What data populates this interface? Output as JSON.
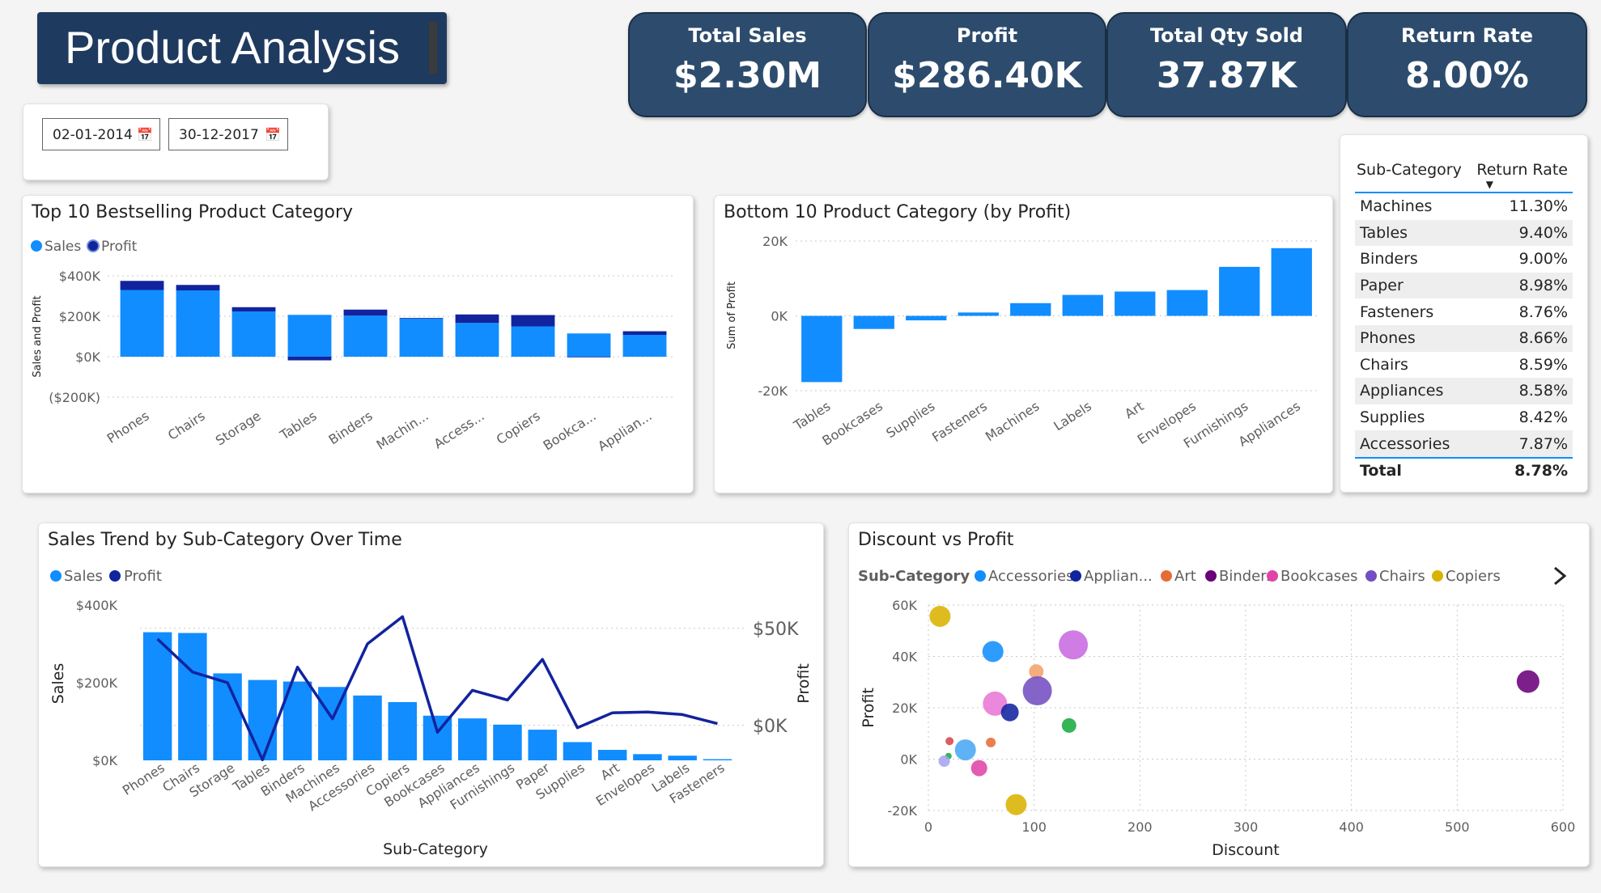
{
  "title": "Product Analysis",
  "kpis": [
    {
      "label": "Total Sales",
      "value": "$2.30M"
    },
    {
      "label": "Profit",
      "value": "$286.40K"
    },
    {
      "label": "Total Qty Sold",
      "value": "37.87K"
    },
    {
      "label": "Return Rate",
      "value": "8.00%"
    }
  ],
  "date_filter": {
    "start": "02-01-2014",
    "end": "30-12-2017"
  },
  "return_table": {
    "headers": [
      "Sub-Category",
      "Return Rate"
    ],
    "rows": [
      {
        "cat": "Machines",
        "rate": "11.30%"
      },
      {
        "cat": "Tables",
        "rate": "9.40%"
      },
      {
        "cat": "Binders",
        "rate": "9.00%"
      },
      {
        "cat": "Paper",
        "rate": "8.98%"
      },
      {
        "cat": "Fasteners",
        "rate": "8.76%"
      },
      {
        "cat": "Phones",
        "rate": "8.66%"
      },
      {
        "cat": "Chairs",
        "rate": "8.59%"
      },
      {
        "cat": "Appliances",
        "rate": "8.58%"
      },
      {
        "cat": "Supplies",
        "rate": "8.42%"
      },
      {
        "cat": "Accessories",
        "rate": "7.87%"
      }
    ],
    "total_label": "Total",
    "total_value": "8.78%"
  },
  "colors": {
    "sales": "#118dff",
    "profit": "#12239e",
    "navy": "#1f3a5f",
    "kpi": "#2d4c6d"
  },
  "chart_data": [
    {
      "id": "top10",
      "type": "bar",
      "title": "Top 10 Bestselling Product Category",
      "legend": [
        "Sales",
        "Profit"
      ],
      "ylabel": "Sales and Profit",
      "ylim": [
        -200000,
        400000
      ],
      "yticks": [
        {
          "v": 400000,
          "label": "$400K"
        },
        {
          "v": 200000,
          "label": "$200K"
        },
        {
          "v": 0,
          "label": "$0K"
        },
        {
          "v": -200000,
          "label": "($200K)"
        }
      ],
      "categories": [
        "Phones",
        "Chairs",
        "Storage",
        "Tables",
        "Binders",
        "Machin...",
        "Access...",
        "Copiers",
        "Bookca...",
        "Applian..."
      ],
      "series": [
        {
          "name": "Sales",
          "values": [
            330000,
            328000,
            224000,
            207000,
            203000,
            189000,
            167000,
            150000,
            115000,
            108000
          ]
        },
        {
          "name": "Profit",
          "values": [
            45000,
            27000,
            21000,
            -18000,
            30000,
            3000,
            42000,
            56000,
            -3000,
            18000
          ]
        }
      ]
    },
    {
      "id": "bottom10",
      "type": "bar",
      "title": "Bottom 10 Product Category (by Profit)",
      "ylabel": "Sum of Profit",
      "ylim": [
        -20000,
        20000
      ],
      "yticks": [
        {
          "v": 20000,
          "label": "20K"
        },
        {
          "v": 0,
          "label": "0K"
        },
        {
          "v": -20000,
          "label": "-20K"
        }
      ],
      "categories": [
        "Tables",
        "Bookcases",
        "Supplies",
        "Fasteners",
        "Machines",
        "Labels",
        "Art",
        "Envelopes",
        "Furnishings",
        "Appliances"
      ],
      "values": [
        -17700,
        -3500,
        -1200,
        900,
        3400,
        5600,
        6500,
        6900,
        13100,
        18100
      ]
    },
    {
      "id": "trend",
      "type": "bar",
      "title": "Sales Trend by Sub-Category Over Time",
      "legend": [
        "Sales",
        "Profit"
      ],
      "xlabel": "Sub-Category",
      "ylabel": "Sales",
      "y2label": "Profit",
      "ylim": [
        0,
        400000
      ],
      "yticks": [
        {
          "v": 400000,
          "label": "$400K"
        },
        {
          "v": 200000,
          "label": "$200K"
        },
        {
          "v": 0,
          "label": "$0K"
        }
      ],
      "y2lim": [
        -18000,
        62000
      ],
      "y2ticks": [
        {
          "v": 50000,
          "label": "$50K"
        },
        {
          "v": 0,
          "label": "$0K"
        }
      ],
      "categories": [
        "Phones",
        "Chairs",
        "Storage",
        "Tables",
        "Binders",
        "Machines",
        "Accessories",
        "Copiers",
        "Bookcases",
        "Appliances",
        "Furnishings",
        "Paper",
        "Supplies",
        "Art",
        "Envelopes",
        "Labels",
        "Fasteners"
      ],
      "series": [
        {
          "name": "Sales",
          "values": [
            330000,
            328000,
            224000,
            207000,
            203000,
            189000,
            167000,
            150000,
            115000,
            108000,
            92000,
            79000,
            47000,
            27000,
            16000,
            12000,
            3000
          ]
        },
        {
          "name": "Profit",
          "values": [
            44500,
            27500,
            22000,
            -17700,
            30000,
            3400,
            42000,
            56000,
            -3500,
            18100,
            13100,
            34000,
            -1200,
            6500,
            6900,
            5600,
            900
          ]
        }
      ]
    },
    {
      "id": "scatter",
      "type": "scatter",
      "title": "Discount vs Profit",
      "legend_title": "Sub-Category",
      "legend": [
        {
          "name": "Accessories",
          "color": "#118dff"
        },
        {
          "name": "Applian...",
          "color": "#12239e"
        },
        {
          "name": "Art",
          "color": "#e66c37"
        },
        {
          "name": "Binders",
          "color": "#6b007b"
        },
        {
          "name": "Bookcases",
          "color": "#e044a7"
        },
        {
          "name": "Chairs",
          "color": "#744ec2"
        },
        {
          "name": "Copiers",
          "color": "#d9b300"
        }
      ],
      "xlabel": "Discount",
      "ylabel": "Profit",
      "xlim": [
        0,
        600
      ],
      "ylim": [
        -20000,
        60000
      ],
      "xticks": [
        {
          "v": 0,
          "label": "0"
        },
        {
          "v": 100,
          "label": "100"
        },
        {
          "v": 200,
          "label": "200"
        },
        {
          "v": 300,
          "label": "300"
        },
        {
          "v": 400,
          "label": "400"
        },
        {
          "v": 500,
          "label": "500"
        },
        {
          "v": 600,
          "label": "600"
        }
      ],
      "yticks": [
        {
          "v": 60000,
          "label": "60K"
        },
        {
          "v": 40000,
          "label": "40K"
        },
        {
          "v": 20000,
          "label": "20K"
        },
        {
          "v": 0,
          "label": "0K"
        },
        {
          "v": -20000,
          "label": "-20K"
        }
      ],
      "points": [
        {
          "x": 11,
          "y": 55600,
          "r": 13,
          "color": "#d9b300"
        },
        {
          "x": 61,
          "y": 41900,
          "r": 13,
          "color": "#118dff"
        },
        {
          "x": 137,
          "y": 44500,
          "r": 18,
          "color": "#c86ae0"
        },
        {
          "x": 102,
          "y": 34100,
          "r": 9,
          "color": "#f2a26b"
        },
        {
          "x": 103,
          "y": 26600,
          "r": 18,
          "color": "#744ec2"
        },
        {
          "x": 63,
          "y": 21600,
          "r": 15,
          "color": "#e877d6"
        },
        {
          "x": 77,
          "y": 18200,
          "r": 11,
          "color": "#12239e"
        },
        {
          "x": 133,
          "y": 13100,
          "r": 9,
          "color": "#1aab40"
        },
        {
          "x": 567,
          "y": 30200,
          "r": 14,
          "color": "#6b007b"
        },
        {
          "x": 20,
          "y": 7000,
          "r": 5,
          "color": "#d64550"
        },
        {
          "x": 59,
          "y": 6500,
          "r": 6,
          "color": "#e66c37"
        },
        {
          "x": 35,
          "y": 3600,
          "r": 13,
          "color": "#4aa7f5"
        },
        {
          "x": 19,
          "y": 1200,
          "r": 4,
          "color": "#1aab40"
        },
        {
          "x": 15,
          "y": -800,
          "r": 7,
          "color": "#a7a3f0"
        },
        {
          "x": 48,
          "y": -3500,
          "r": 10,
          "color": "#e044a7"
        },
        {
          "x": 83,
          "y": -17700,
          "r": 13,
          "color": "#d9b300"
        }
      ]
    }
  ]
}
